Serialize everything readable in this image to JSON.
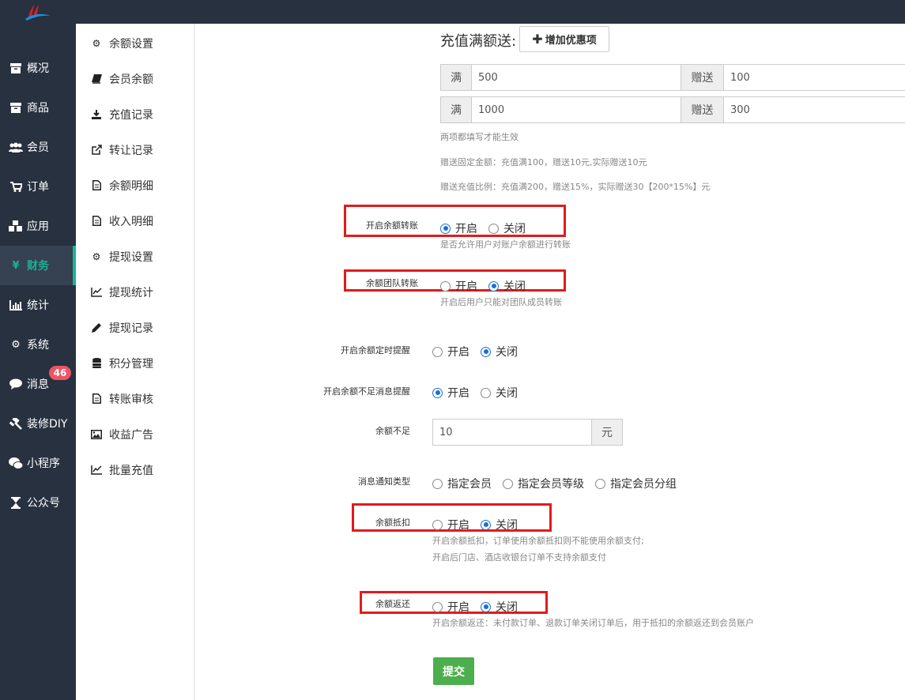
{
  "topbar": {
    "logo_icon": "brand-logo"
  },
  "left_nav": [
    {
      "label": "概况",
      "icon": "archive-icon"
    },
    {
      "label": "商品",
      "icon": "archive-icon"
    },
    {
      "label": "会员",
      "icon": "users-icon"
    },
    {
      "label": "订单",
      "icon": "cart-icon"
    },
    {
      "label": "应用",
      "icon": "cubes-icon"
    },
    {
      "label": "财务",
      "icon": "yen-icon",
      "active": true
    },
    {
      "label": "统计",
      "icon": "bar-chart-icon"
    },
    {
      "label": "系统",
      "icon": "gears-icon"
    },
    {
      "label": "消息",
      "icon": "comment-icon",
      "badge": "46"
    },
    {
      "label": "装修DIY",
      "icon": "gavel-icon"
    },
    {
      "label": "小程序",
      "icon": "wechat-icon"
    },
    {
      "label": "公众号",
      "icon": "hourglass-icon"
    }
  ],
  "sub_nav": [
    {
      "label": "余额设置",
      "icon": "gear-icon"
    },
    {
      "label": "会员余额",
      "icon": "book-icon"
    },
    {
      "label": "充值记录",
      "icon": "download-icon"
    },
    {
      "label": "转让记录",
      "icon": "external-link-icon"
    },
    {
      "label": "余额明细",
      "icon": "file-icon"
    },
    {
      "label": "收入明细",
      "icon": "file-icon"
    },
    {
      "label": "提现设置",
      "icon": "gear-icon"
    },
    {
      "label": "提现统计",
      "icon": "line-chart-icon"
    },
    {
      "label": "提现记录",
      "icon": "pencil-icon"
    },
    {
      "label": "积分管理",
      "icon": "database-icon"
    },
    {
      "label": "转账审核",
      "icon": "file-icon"
    },
    {
      "label": "收益广告",
      "icon": "image-icon"
    },
    {
      "label": "批量充值",
      "icon": "line-chart-icon"
    }
  ],
  "recharge": {
    "title": "充值满额送:",
    "add_button": "增加优惠项",
    "rows": [
      {
        "full_label": "满",
        "full_value": "500",
        "gift_label": "赠送",
        "gift_value": "100"
      },
      {
        "full_label": "满",
        "full_value": "1000",
        "gift_label": "赠送",
        "gift_value": "300"
      }
    ],
    "hints": [
      "两项都填写才能生效",
      "赠送固定金额：充值满100，赠送10元,实际赠送10元",
      "赠送充值比例：充值满200，赠送15%，实际赠送30【200*15%】元"
    ]
  },
  "settings": {
    "open_label": "开启",
    "close_label": "关闭",
    "balance_transfer": {
      "label": "开启余额转账",
      "value": "open",
      "hint": "是否允许用户对账户余额进行转账"
    },
    "team_transfer": {
      "label": "余额团队转账",
      "value": "close",
      "hint": "开启后用户只能对团队成员转账"
    },
    "timed_reminder": {
      "label": "开启余额定时提醒",
      "value": "close"
    },
    "low_balance_reminder": {
      "label": "开启余额不足消息提醒",
      "value": "open"
    },
    "low_balance": {
      "label": "余额不足",
      "value": "10",
      "unit": "元"
    },
    "notify_type": {
      "label": "消息通知类型",
      "options": [
        "指定会员",
        "指定会员等级",
        "指定会员分组"
      ],
      "selected": null
    },
    "deduction": {
      "label": "余额抵扣",
      "value": "close",
      "hints": [
        "开启余额抵扣，订单使用余额抵扣则不能使用余额支付;",
        "开启后门店、酒店收银台订单不支持余额支付"
      ]
    },
    "refund": {
      "label": "余额返还",
      "value": "close",
      "hint": "开启余额返还：未付款订单、退款订单关闭订单后，用于抵扣的余额返还到会员账户"
    }
  },
  "submit_label": "提交",
  "colors": {
    "nav_bg": "#27313f",
    "accent": "#1ab394",
    "radio": "#1a6fd1",
    "highlight_box": "#e21b1b",
    "submit": "#4cae4c",
    "badge": "#ed5565"
  }
}
